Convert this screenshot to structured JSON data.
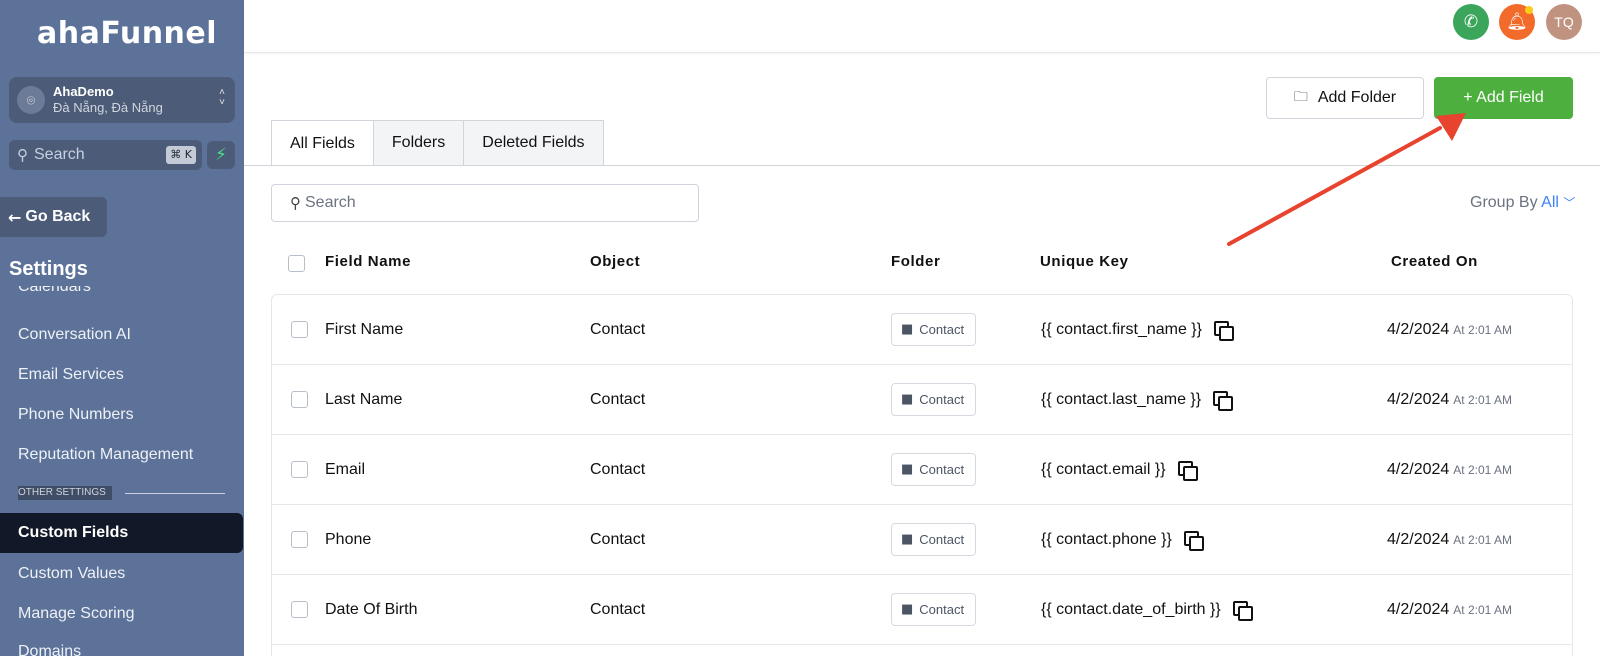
{
  "brand": {
    "logo_text": "ahaFunnel"
  },
  "account": {
    "name": "AhaDemo",
    "location": "Đà Nẵng, Đà Nẵng"
  },
  "sidebar_search": {
    "placeholder": "Search",
    "shortcut": "⌘ K"
  },
  "go_back_label": "Go Back",
  "settings_title": "Settings",
  "nav": {
    "items_top": [
      "Calendars",
      "Conversation AI",
      "Email Services",
      "Phone Numbers",
      "Reputation Management"
    ],
    "section_label": "OTHER SETTINGS",
    "active_item": "Custom Fields",
    "items_bottom": [
      "Custom Values",
      "Manage Scoring",
      "Domains"
    ]
  },
  "topbar": {
    "avatar_initials": "TQ"
  },
  "actions": {
    "add_folder": "Add Folder",
    "add_field": "+ Add Field"
  },
  "tabs": [
    "All Fields",
    "Folders",
    "Deleted Fields"
  ],
  "search": {
    "placeholder": "Search"
  },
  "group_by": {
    "label": "Group By",
    "value": "All"
  },
  "table": {
    "headers": [
      "Field Name",
      "Object",
      "Folder",
      "Unique Key",
      "Created On"
    ],
    "rows": [
      {
        "name": "First Name",
        "object": "Contact",
        "folder": "Contact",
        "key": "{{ contact.first_name }}",
        "date": "4/2/2024",
        "time": "At 2:01 AM"
      },
      {
        "name": "Last Name",
        "object": "Contact",
        "folder": "Contact",
        "key": "{{ contact.last_name }}",
        "date": "4/2/2024",
        "time": "At 2:01 AM"
      },
      {
        "name": "Email",
        "object": "Contact",
        "folder": "Contact",
        "key": "{{ contact.email }}",
        "date": "4/2/2024",
        "time": "At 2:01 AM"
      },
      {
        "name": "Phone",
        "object": "Contact",
        "folder": "Contact",
        "key": "{{ contact.phone }}",
        "date": "4/2/2024",
        "time": "At 2:01 AM"
      },
      {
        "name": "Date Of Birth",
        "object": "Contact",
        "folder": "Contact",
        "key": "{{ contact.date_of_birth }}",
        "date": "4/2/2024",
        "time": "At 2:01 AM"
      }
    ]
  },
  "colors": {
    "sidebar_bg": "#5d7299",
    "primary_green": "#4caf3e",
    "annotation_arrow": "#e8432e",
    "link_blue": "#3b82f6"
  }
}
